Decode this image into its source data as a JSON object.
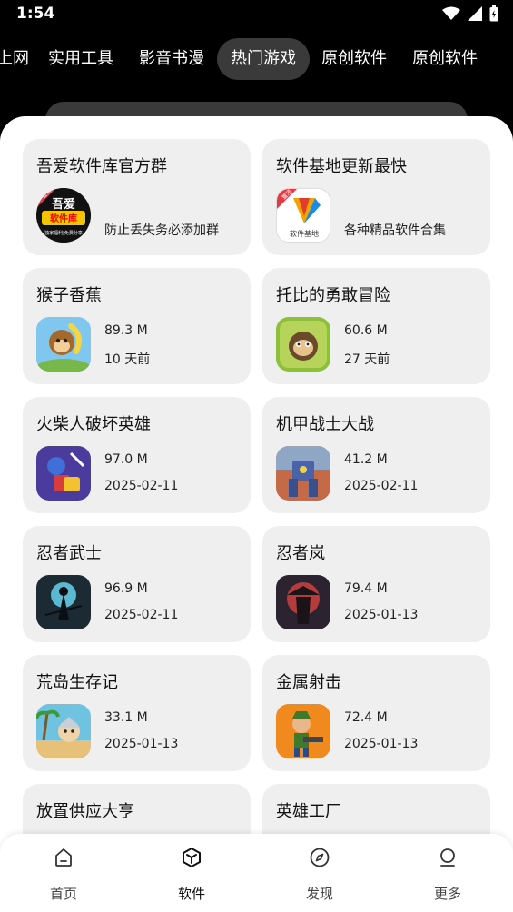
{
  "status": {
    "time": "1:54"
  },
  "tabs": [
    {
      "label": "上网"
    },
    {
      "label": "实用工具"
    },
    {
      "label": "影音书漫"
    },
    {
      "label": "热门游戏"
    },
    {
      "label": "原创软件"
    },
    {
      "label": "原创软件"
    }
  ],
  "cards": [
    {
      "title": "吾爱软件库官方群",
      "desc": "防止丢失务必添加群",
      "icon": "qq-group-icon",
      "icon_text": "吾爱软件库",
      "icon_sub": "独家福利|免费分享"
    },
    {
      "title": "软件基地更新最快",
      "desc": "各种精品软件合集",
      "icon": "software-base-icon",
      "icon_text": "软件基地"
    },
    {
      "title": "猴子香蕉",
      "size": "89.3 M",
      "date": "10 天前",
      "icon": "monkey-game-icon"
    },
    {
      "title": "托比的勇敢冒险",
      "size": "60.6 M",
      "date": "27 天前",
      "icon": "adventure-game-icon"
    },
    {
      "title": "火柴人破坏英雄",
      "size": "97.0 M",
      "date": "2025-02-11",
      "icon": "stickman-game-icon"
    },
    {
      "title": "机甲战士大战",
      "size": "41.2 M",
      "date": "2025-02-11",
      "icon": "mecha-game-icon"
    },
    {
      "title": "忍者武士",
      "size": "96.9 M",
      "date": "2025-02-11",
      "icon": "ninja-game-icon"
    },
    {
      "title": "忍者岚",
      "size": "79.4 M",
      "date": "2025-01-13",
      "icon": "ninja-arashi-icon"
    },
    {
      "title": "荒岛生存记",
      "size": "33.1 M",
      "date": "2025-01-13",
      "icon": "island-game-icon"
    },
    {
      "title": "金属射击",
      "size": "72.4 M",
      "date": "2025-01-13",
      "icon": "metal-shooter-icon"
    },
    {
      "title": "放置供应大亨"
    },
    {
      "title": "英雄工厂"
    }
  ],
  "nav": [
    {
      "label": "首页",
      "icon": "home-icon"
    },
    {
      "label": "软件",
      "icon": "box-icon"
    },
    {
      "label": "发现",
      "icon": "compass-icon"
    },
    {
      "label": "更多",
      "icon": "profile-icon"
    }
  ],
  "colors": {
    "accent_tab": "#3a3a3a",
    "card_bg": "#efefef"
  }
}
